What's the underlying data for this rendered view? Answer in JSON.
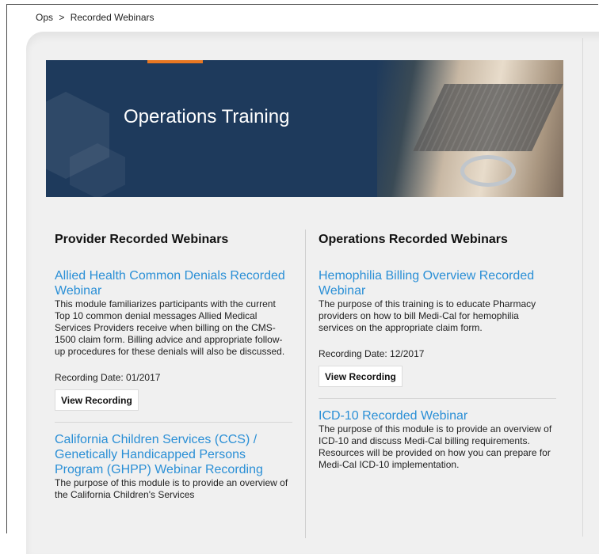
{
  "breadcrumb": {
    "root": "Ops",
    "separator": ">",
    "current": "Recorded Webinars"
  },
  "banner": {
    "title": "Operations Training"
  },
  "left": {
    "heading": "Provider Recorded Webinars",
    "items": [
      {
        "title": "Allied Health Common Denials Recorded Webinar",
        "desc": "This module familiarizes participants with the current Top 10 common denial messages Allied Medical Services Providers receive when billing on the CMS-1500 claim form. Billing advice and appropriate follow-up procedures for these denials will also be discussed.",
        "date": "Recording Date: 01/2017",
        "button": "View Recording"
      },
      {
        "title": "California Children Services (CCS) / Genetically Handicapped Persons Program (GHPP) Webinar Recording",
        "desc": "The purpose of this module is to provide an overview of the California Children's Services"
      }
    ]
  },
  "right": {
    "heading": "Operations Recorded Webinars",
    "items": [
      {
        "title": "Hemophilia Billing Overview Recorded Webinar",
        "desc": "The purpose of this training is to educate Pharmacy providers on how to bill Medi-Cal for hemophilia services on the appropriate claim form.",
        "date": "Recording Date: 12/2017",
        "button": "View Recording"
      },
      {
        "title": "ICD-10 Recorded Webinar",
        "desc": "The purpose of this module is to provide an overview of ICD-10 and discuss Medi-Cal billing requirements. Resources will be provided on how you can prepare for Medi-Cal ICD-10 implementation."
      }
    ]
  }
}
